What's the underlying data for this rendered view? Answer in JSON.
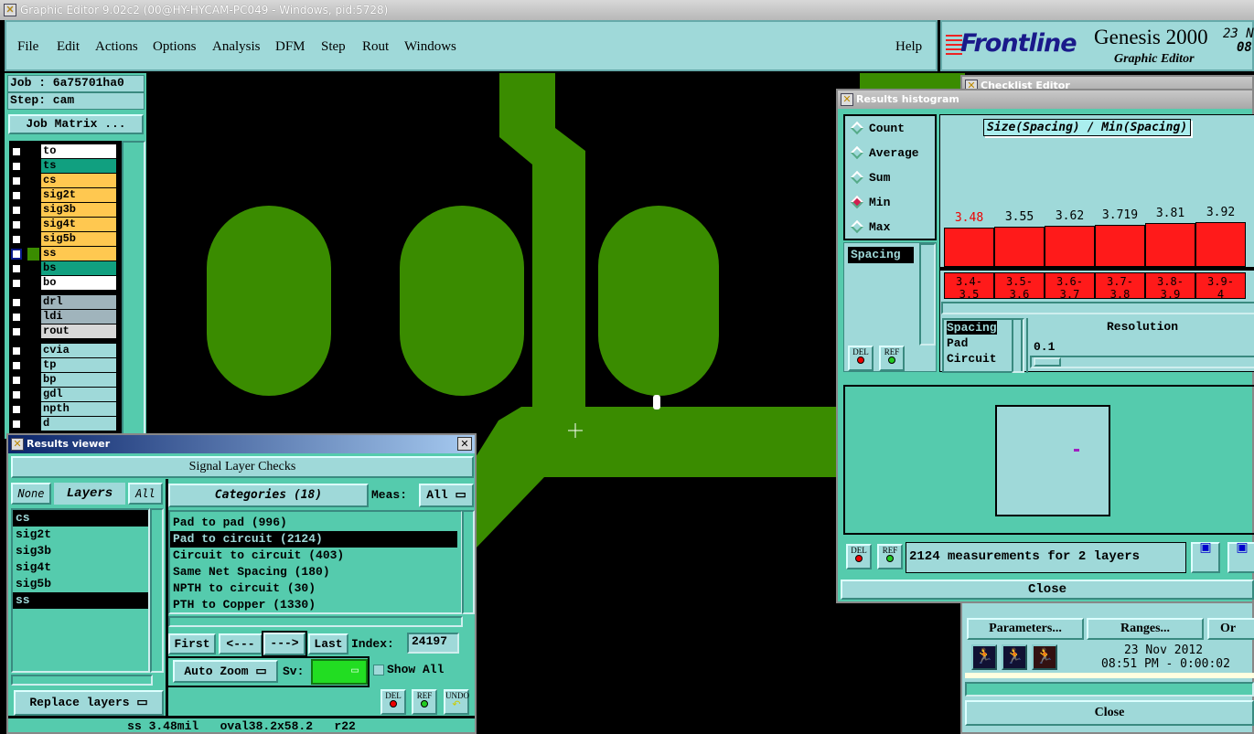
{
  "window": {
    "title": "Graphic Editor 9.02c2 (00@HY-HYCAM-PC049 - Windows, pid:5728)"
  },
  "menu": [
    "File",
    "Edit",
    "Actions",
    "Options",
    "Analysis",
    "DFM",
    "Step",
    "Rout",
    "Windows"
  ],
  "help": "Help",
  "logo": {
    "brand": "Frontline",
    "product": "Genesis 2000",
    "subtitle": "Graphic Editor",
    "date_partial": "23 N",
    "time_partial": "08."
  },
  "job": {
    "job": "Job : 6a75701ha0",
    "step": "Step: cam",
    "matrix_button": "Job Matrix ..."
  },
  "layers": [
    {
      "name": "to",
      "color": "#ffffff"
    },
    {
      "name": "ts",
      "color": "#11a080"
    },
    {
      "name": "cs",
      "color": "#ffc850"
    },
    {
      "name": "sig2t",
      "color": "#ffc850"
    },
    {
      "name": "sig3b",
      "color": "#ffc850"
    },
    {
      "name": "sig4t",
      "color": "#ffc850"
    },
    {
      "name": "sig5b",
      "color": "#ffc850"
    },
    {
      "name": "ss",
      "color": "#ffc850",
      "active": true
    },
    {
      "name": "bs",
      "color": "#11a080"
    },
    {
      "name": "bo",
      "color": "#ffffff"
    },
    {
      "name": "drl",
      "color": "#a0b4bc"
    },
    {
      "name": "ldi",
      "color": "#a0b4bc"
    },
    {
      "name": "rout",
      "color": "#d8d8d8"
    },
    {
      "name": "cvia",
      "color": "#9fd9d9"
    },
    {
      "name": "tp",
      "color": "#9fd9d9"
    },
    {
      "name": "bp",
      "color": "#9fd9d9"
    },
    {
      "name": "gdl",
      "color": "#9fd9d9"
    },
    {
      "name": "npth",
      "color": "#9fd9d9"
    },
    {
      "name": "d",
      "color": "#9fd9d9"
    }
  ],
  "results_viewer": {
    "title": "Results viewer",
    "header": "Signal Layer Checks",
    "none": "None",
    "layers_label": "Layers",
    "all": "All",
    "layer_list": [
      {
        "name": "cs",
        "selected": true
      },
      {
        "name": "sig2t"
      },
      {
        "name": "sig3b"
      },
      {
        "name": "sig4t"
      },
      {
        "name": "sig5b"
      },
      {
        "name": "ss",
        "selected": true
      }
    ],
    "categories_label": "Categories (18)",
    "meas_label": "Meas:",
    "meas_value": "All",
    "categories": [
      {
        "name": "Pad to pad (996)"
      },
      {
        "name": "Pad to circuit (2124)",
        "selected": true
      },
      {
        "name": "Circuit to circuit (403)"
      },
      {
        "name": "Same Net Spacing (180)"
      },
      {
        "name": "NPTH to circuit (30)"
      },
      {
        "name": "PTH to Copper (1330)"
      }
    ],
    "first": "First",
    "prev": "<---",
    "next": "--->",
    "last": "Last",
    "index_label": "Index:",
    "index_value": "24197",
    "auto_zoom": "Auto Zoom",
    "sv_label": "Sv:",
    "show_all": "Show All",
    "replace_layers": "Replace layers",
    "del": "DEL",
    "ref": "REF",
    "undo": "UNDO",
    "status": "ss 3.48mil   oval38.2x58.2   r22"
  },
  "histogram": {
    "title": "Results histogram",
    "modes": [
      "Count",
      "Average",
      "Sum",
      "Min",
      "Max"
    ],
    "selected_mode": "Min",
    "field_list": [
      "Spacing"
    ],
    "chart_title": "Size(Spacing) / Min(Spacing)",
    "bars": [
      {
        "value": "3.48",
        "range": "3.4- 3.5",
        "highlight": true
      },
      {
        "value": "3.55",
        "range": "3.5- 3.6"
      },
      {
        "value": "3.62",
        "range": "3.6- 3.7"
      },
      {
        "value": "3.719",
        "range": "3.7- 3.8"
      },
      {
        "value": "3.81",
        "range": "3.8- 3.9"
      },
      {
        "value": "3.92",
        "range": "3.9- 4"
      }
    ],
    "size_list": [
      {
        "name": "Spacing",
        "selected": true
      },
      {
        "name": "Pad"
      },
      {
        "name": "Circuit"
      }
    ],
    "resolution_label": "Resolution",
    "resolution_value": "0.1",
    "del": "DEL",
    "ref": "REF",
    "status": "2124 measurements for 2 layers",
    "close": "Close",
    "bar_color": "#ff1a1a"
  },
  "checklist": {
    "title": "Checklist Editor",
    "parameters": "Parameters...",
    "ranges": "Ranges...",
    "other_partial": "Or",
    "date": "23 Nov 2012",
    "time": "08:51 PM - 0:00:02",
    "close": "Close"
  },
  "colors": {
    "copper": "#3a8c00",
    "panel": "#55cbad",
    "light": "#9fd9d9"
  }
}
